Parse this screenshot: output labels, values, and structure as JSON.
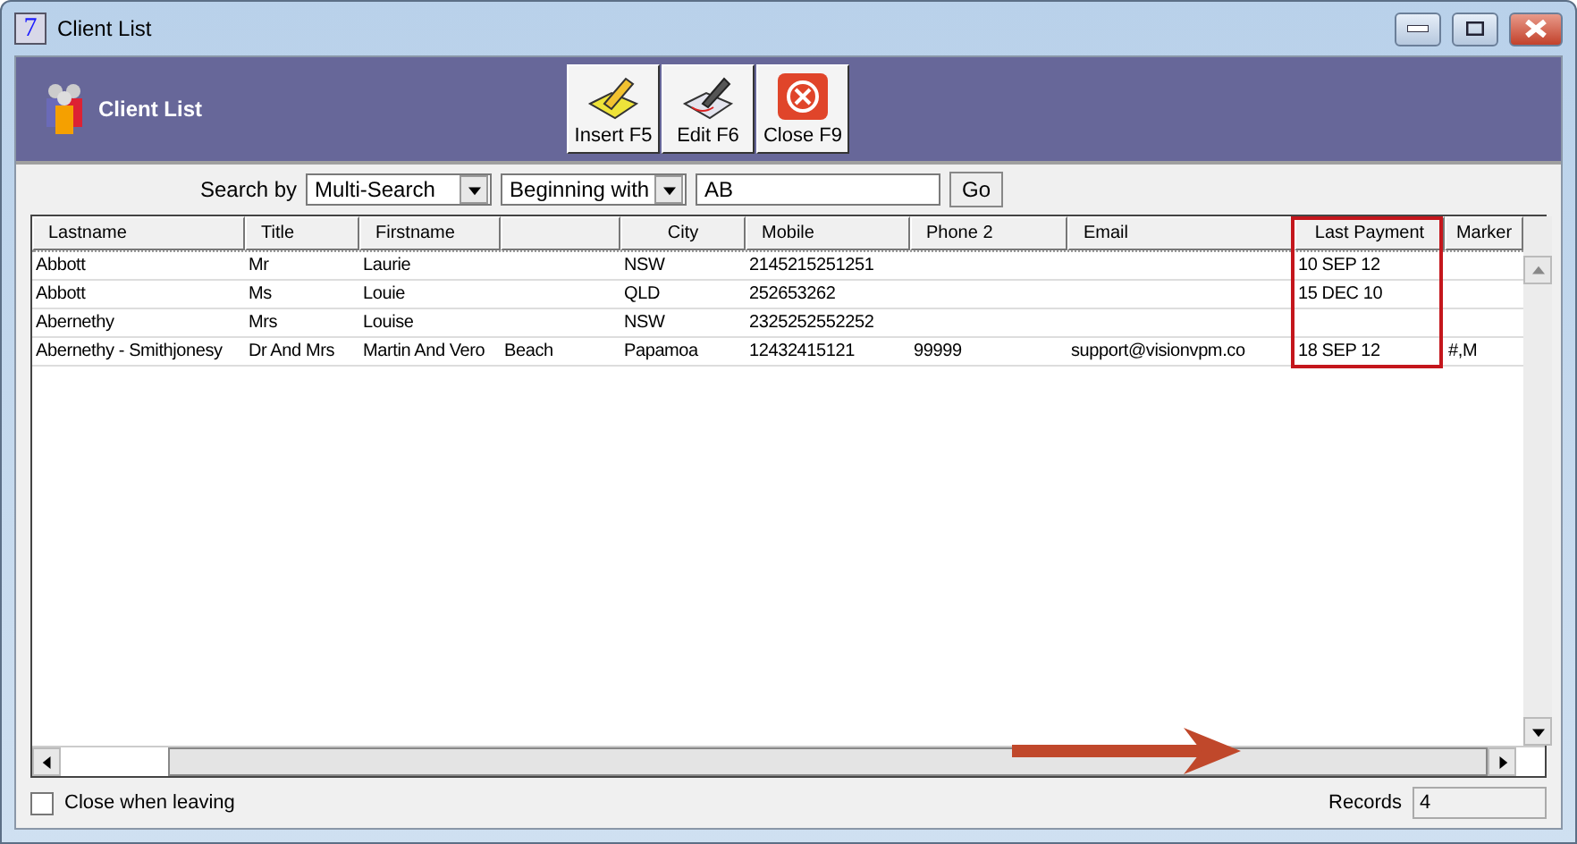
{
  "window": {
    "title": "Client List",
    "app_icon": "7"
  },
  "header": {
    "title": "Client List"
  },
  "toolbar": [
    {
      "label": "Insert F5",
      "kind": "insert"
    },
    {
      "label": "Edit F6",
      "kind": "edit"
    },
    {
      "label": "Close F9",
      "kind": "close"
    }
  ],
  "search": {
    "label": "Search by",
    "field": "Multi-Search",
    "mode": "Beginning with",
    "value": "AB",
    "button": "Go"
  },
  "table": {
    "columns": [
      {
        "label": "Lastname",
        "outlined": false
      },
      {
        "label": "Title",
        "outlined": false
      },
      {
        "label": "Firstname",
        "outlined": false
      },
      {
        "outlined": false
      },
      {
        "label": "City",
        "outlined": false
      },
      {
        "label": "Mobile",
        "outlined": false
      },
      {
        "label": "Phone 2",
        "outlined": false
      },
      {
        "label": "Email",
        "outlined": false
      },
      {
        "label": "Last Payment",
        "outlined": true
      },
      {
        "label": "Marker",
        "outlined": false
      }
    ],
    "rows": [
      {
        "cells": [
          "Abbott",
          "Mr",
          "Laurie",
          null,
          "NSW",
          "2145215251251",
          null,
          null,
          "10 SEP 12",
          null
        ]
      },
      {
        "cells": [
          "Abbott",
          "Ms",
          "Louie",
          null,
          "QLD",
          "252653262",
          null,
          null,
          "15 DEC 10",
          null
        ]
      },
      {
        "cells": [
          "Abernethy",
          "Mrs",
          "Louise",
          null,
          "NSW",
          "2325252552252",
          null,
          null,
          null,
          null
        ]
      },
      {
        "cells": [
          "Abernethy - Smithjonesy",
          "Dr And Mrs",
          "Martin And Vero",
          "Beach",
          "Papamoa",
          "12432415121",
          "99999",
          "support@visionvpm.co",
          "18 SEP 12",
          "#,M"
        ]
      }
    ]
  },
  "annotations": {
    "arrow_shown": true
  },
  "footer": {
    "close_when_leaving": {
      "label": "Close when leaving",
      "checked": false
    },
    "records_label": "Records",
    "records": "4"
  }
}
